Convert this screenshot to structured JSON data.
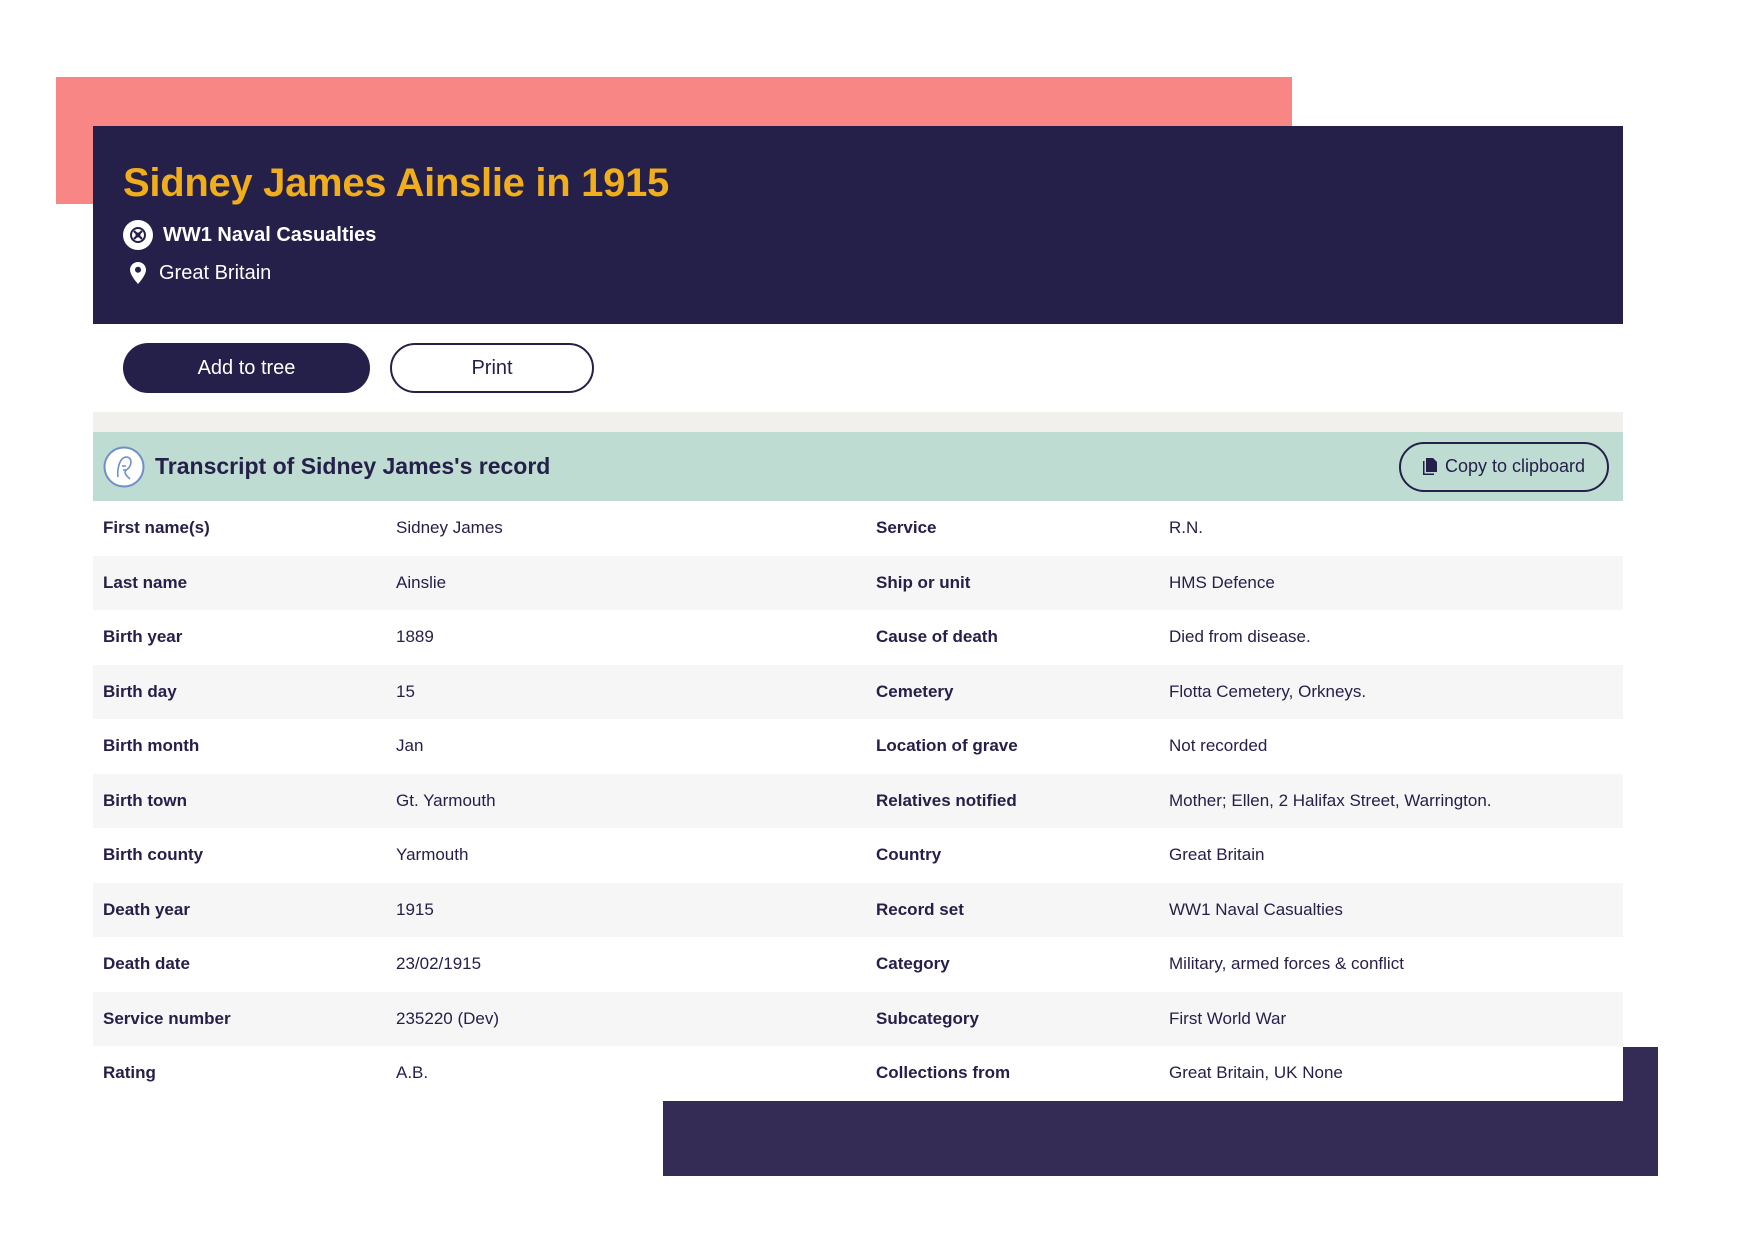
{
  "header": {
    "title": "Sidney James Ainslie in 1915",
    "record_set": "WW1 Naval Casualties",
    "location": "Great Britain"
  },
  "actions": {
    "add_to_tree": "Add to tree",
    "print": "Print"
  },
  "transcript": {
    "title": "Transcript of Sidney James's record",
    "copy_label": "Copy to clipboard",
    "rows": [
      {
        "l1": "First name(s)",
        "v1": "Sidney James",
        "l2": "Service",
        "v2": "R.N."
      },
      {
        "l1": "Last name",
        "v1": "Ainslie",
        "l2": "Ship or unit",
        "v2": "HMS Defence"
      },
      {
        "l1": "Birth year",
        "v1": "1889",
        "l2": "Cause of death",
        "v2": "Died from disease."
      },
      {
        "l1": "Birth day",
        "v1": "15",
        "l2": "Cemetery",
        "v2": "Flotta Cemetery, Orkneys."
      },
      {
        "l1": "Birth month",
        "v1": "Jan",
        "l2": "Location of grave",
        "v2": "Not recorded"
      },
      {
        "l1": "Birth town",
        "v1": "Gt. Yarmouth",
        "l2": "Relatives notified",
        "v2": "Mother; Ellen, 2 Halifax Street, Warrington."
      },
      {
        "l1": "Birth county",
        "v1": "Yarmouth",
        "l2": "Country",
        "v2": "Great Britain"
      },
      {
        "l1": "Death year",
        "v1": "1915",
        "l2": "Record set",
        "v2": "WW1 Naval Casualties"
      },
      {
        "l1": "Death date",
        "v1": "23/02/1915",
        "l2": "Category",
        "v2": "Military, armed forces & conflict"
      },
      {
        "l1": "Service number",
        "v1": "235220 (Dev)",
        "l2": "Subcategory",
        "v2": "First World War"
      },
      {
        "l1": "Rating",
        "v1": "A.B.",
        "l2": "Collections from",
        "v2": "Great Britain, UK None"
      }
    ]
  },
  "colors": {
    "navy": "#25204a",
    "gold": "#f0ad1c",
    "coral": "#f78684",
    "mint": "#bfdcd3"
  },
  "icons": [
    "naval-badge-icon",
    "location-pin-icon",
    "portrait-icon",
    "document-copy-icon"
  ]
}
